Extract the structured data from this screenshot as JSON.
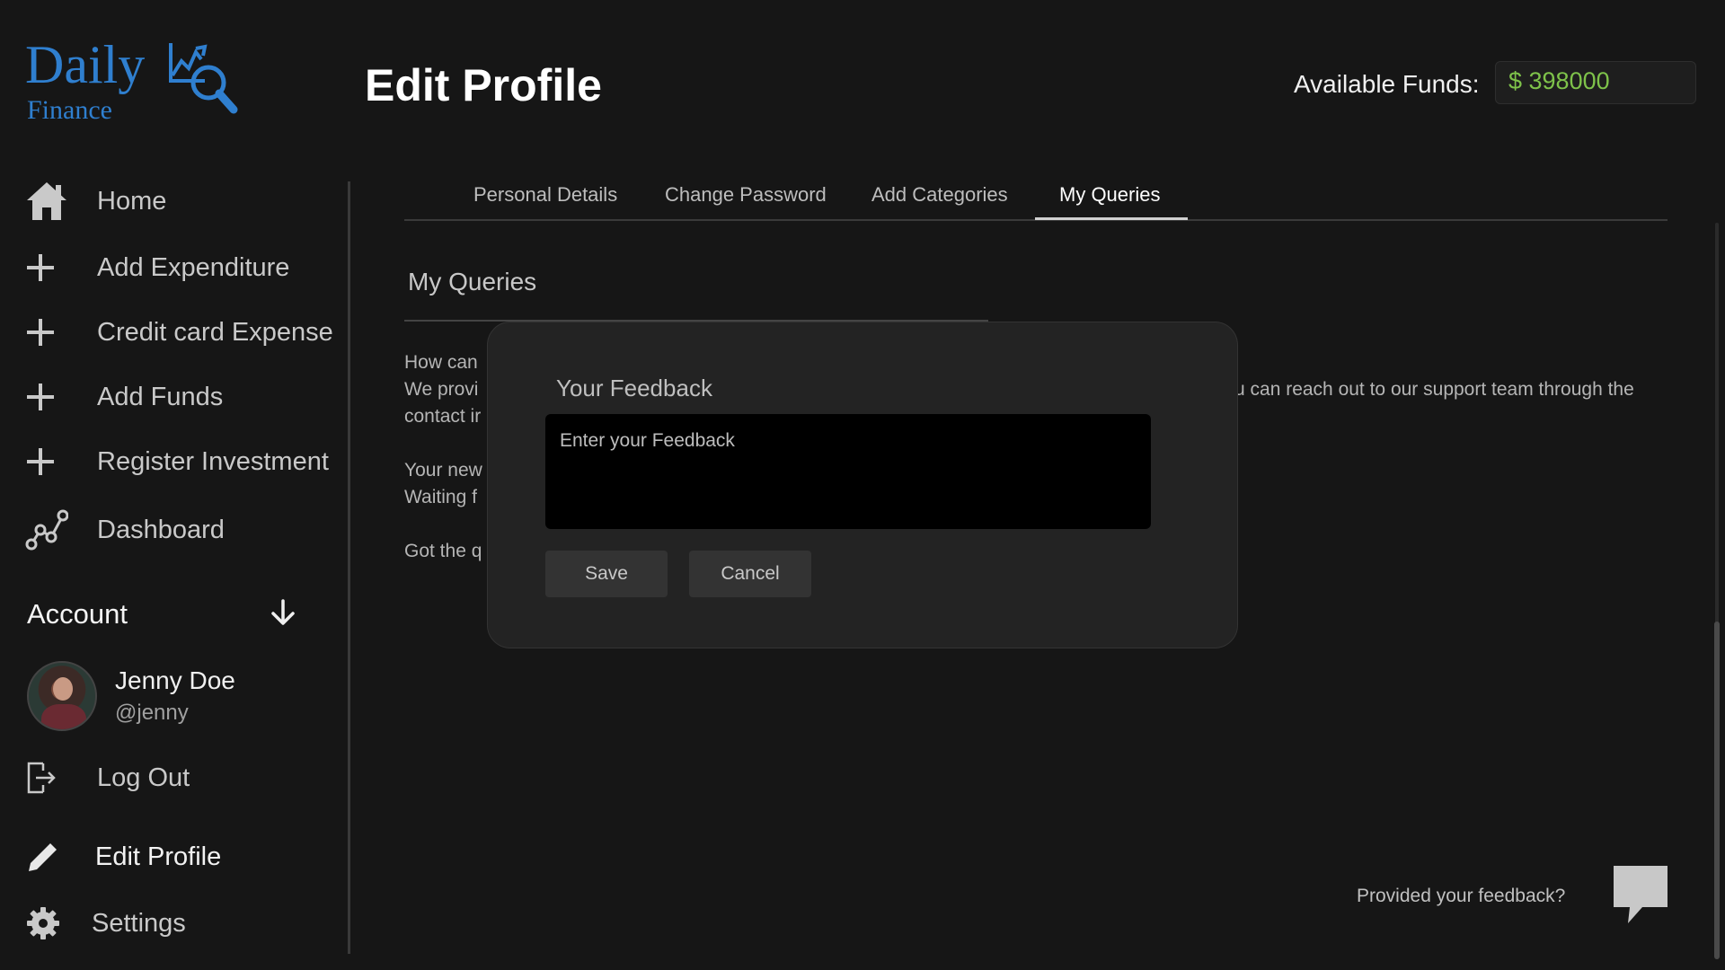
{
  "brand": {
    "line1": "Daily",
    "line2": "Finance"
  },
  "header": {
    "title": "Edit Profile",
    "funds_label": "Available Funds:",
    "funds_value": "$ 398000"
  },
  "sidebar": {
    "items": [
      {
        "label": "Home",
        "icon": "home-icon"
      },
      {
        "label": "Add Expenditure",
        "icon": "plus-icon"
      },
      {
        "label": "Credit card Expense",
        "icon": "plus-icon"
      },
      {
        "label": "Add Funds",
        "icon": "plus-icon"
      },
      {
        "label": "Register Investment",
        "icon": "plus-icon"
      },
      {
        "label": "Dashboard",
        "icon": "chart-line-icon"
      }
    ],
    "account_title": "Account",
    "user": {
      "name": "Jenny Doe",
      "handle": "@jenny"
    },
    "logout": "Log Out",
    "edit_profile": "Edit Profile",
    "settings": "Settings"
  },
  "tabs": [
    {
      "label": "Personal Details"
    },
    {
      "label": "Change Password"
    },
    {
      "label": "Add Categories"
    },
    {
      "label": "My Queries",
      "active": true
    }
  ],
  "section": {
    "title": "My Queries",
    "line1": "How can",
    "line2_start": "We provi",
    "line2_end": "u can reach out to our support team through the",
    "line3": "contact ir",
    "line4": "Your new",
    "line5": "Waiting f",
    "line6": "Got the q"
  },
  "modal": {
    "title": "Your Feedback",
    "placeholder": "Enter your Feedback",
    "save": "Save",
    "cancel": "Cancel"
  },
  "footer": {
    "feedback_prompt": "Provided your feedback?"
  },
  "colors": {
    "background": "#161616",
    "brand_blue": "#2f7fcf",
    "funds_green": "#7ec24a"
  }
}
